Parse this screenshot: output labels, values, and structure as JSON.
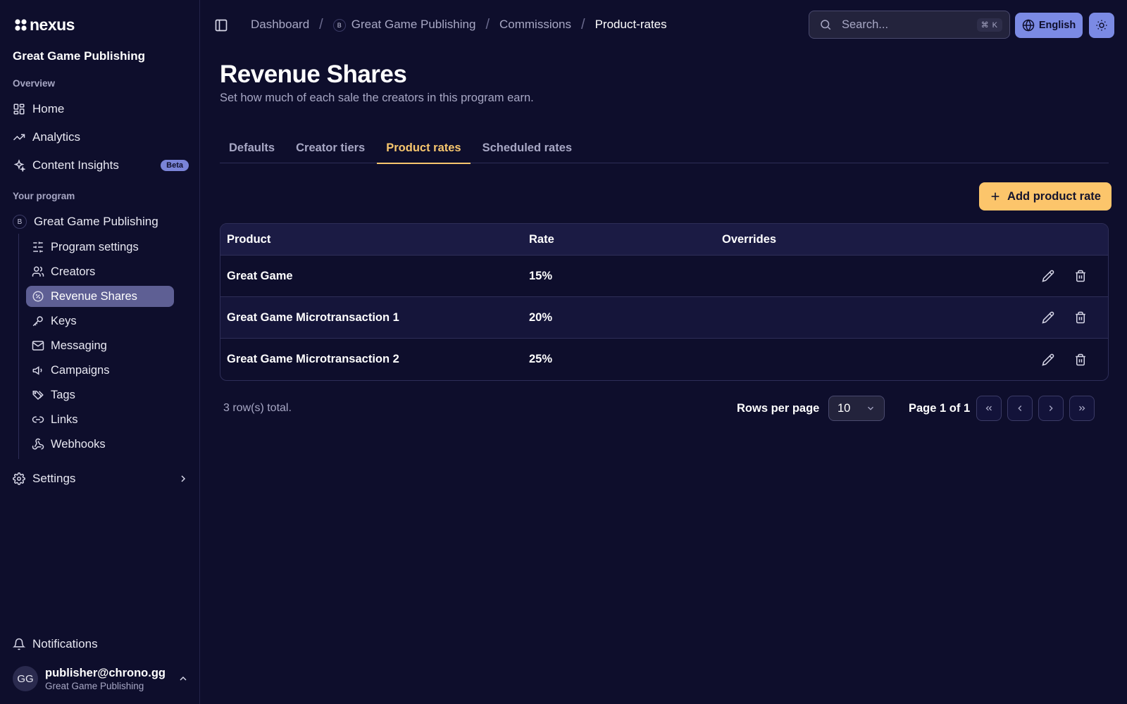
{
  "app": {
    "logo_text": "nexus"
  },
  "sidebar": {
    "org_title": "Great Game Publishing",
    "overview_label": "Overview",
    "overview_items": [
      {
        "label": "Home",
        "icon": "home-grid-icon"
      },
      {
        "label": "Analytics",
        "icon": "trending-up-icon"
      },
      {
        "label": "Content Insights",
        "icon": "sparkles-icon",
        "badge": "Beta"
      }
    ],
    "program_label": "Your program",
    "program": {
      "badge": "B",
      "name": "Great Game Publishing"
    },
    "program_items": [
      {
        "label": "Program settings",
        "icon": "sliders-icon"
      },
      {
        "label": "Creators",
        "icon": "users-icon"
      },
      {
        "label": "Revenue Shares",
        "icon": "percent-badge-icon",
        "active": true
      },
      {
        "label": "Keys",
        "icon": "key-icon"
      },
      {
        "label": "Messaging",
        "icon": "mail-icon"
      },
      {
        "label": "Campaigns",
        "icon": "megaphone-icon"
      },
      {
        "label": "Tags",
        "icon": "tags-icon"
      },
      {
        "label": "Links",
        "icon": "link-icon"
      },
      {
        "label": "Webhooks",
        "icon": "webhook-icon"
      }
    ],
    "settings_label": "Settings",
    "notifications_label": "Notifications",
    "user": {
      "initials": "GG",
      "email": "publisher@chrono.gg",
      "org": "Great Game Publishing"
    }
  },
  "topbar": {
    "breadcrumb": [
      {
        "label": "Dashboard"
      },
      {
        "label": "Great Game Publishing",
        "badge": "B"
      },
      {
        "label": "Commissions"
      },
      {
        "label": "Product-rates",
        "current": true
      }
    ],
    "search_placeholder": "Search...",
    "search_shortcut": "⌘ K",
    "language": "English"
  },
  "page": {
    "title": "Revenue Shares",
    "subtitle": "Set how much of each sale the creators in this program earn.",
    "tabs": [
      {
        "label": "Defaults"
      },
      {
        "label": "Creator tiers"
      },
      {
        "label": "Product rates",
        "active": true
      },
      {
        "label": "Scheduled rates"
      }
    ],
    "add_button": "Add product rate"
  },
  "table": {
    "columns": [
      "Product",
      "Rate",
      "Overrides"
    ],
    "rows": [
      {
        "product": "Great Game",
        "rate": "15%",
        "overrides": ""
      },
      {
        "product": "Great Game Microtransaction 1",
        "rate": "20%",
        "overrides": ""
      },
      {
        "product": "Great Game Microtransaction 2",
        "rate": "25%",
        "overrides": ""
      }
    ]
  },
  "pagination": {
    "rows_total": "3 row(s) total.",
    "rows_per_page_label": "Rows per page",
    "rows_per_page_value": "10",
    "page_info": "Page 1 of 1"
  },
  "colors": {
    "background": "#0e0e2c",
    "accent": "#fcc56b",
    "active_tab": "#f7c66e",
    "language_button": "#7b8ae4",
    "active_nav": "#5e5f94",
    "beta_badge": "#7a84d8"
  }
}
